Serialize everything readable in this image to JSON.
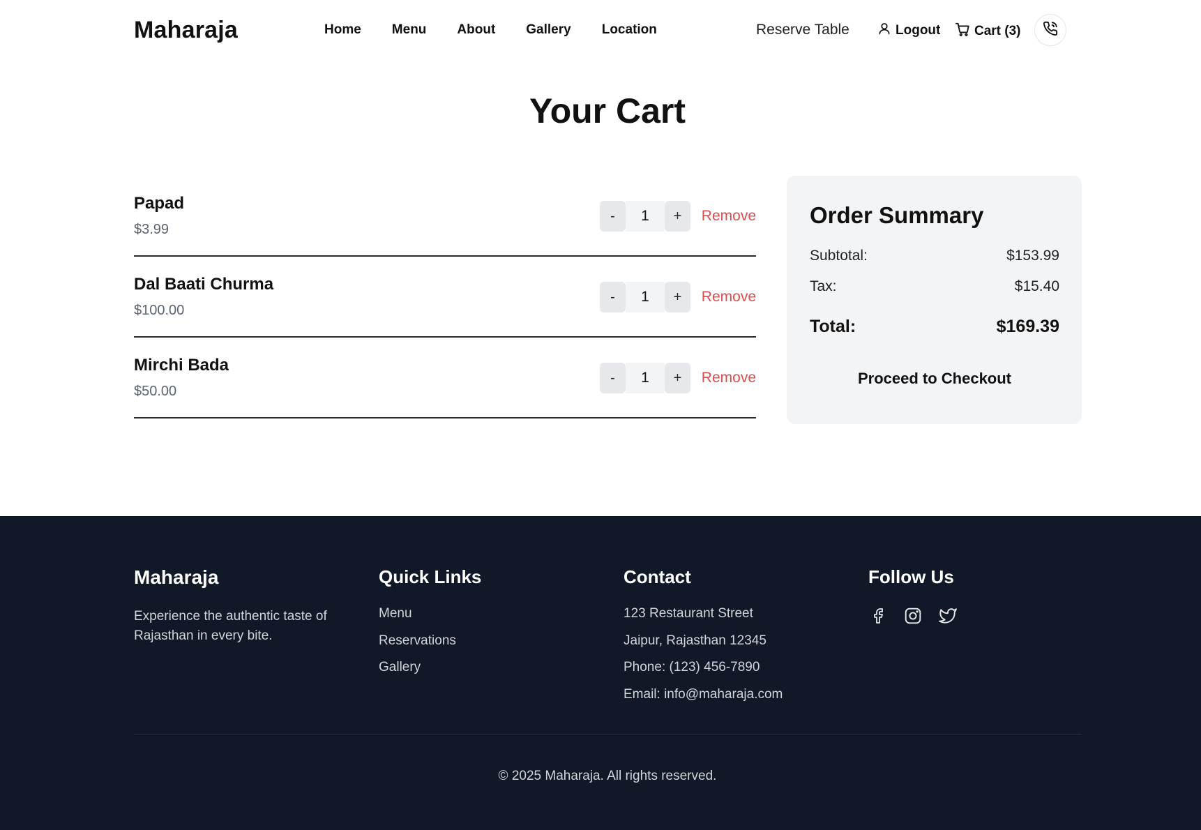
{
  "header": {
    "brand": "Maharaja",
    "nav": [
      "Home",
      "Menu",
      "About",
      "Gallery",
      "Location"
    ],
    "reserve_label": "Reserve Table",
    "logout_label": "Logout",
    "cart_label": "Cart (3)"
  },
  "page": {
    "title": "Your Cart"
  },
  "cart": {
    "items": [
      {
        "name": "Papad",
        "price": "$3.99",
        "qty": "1",
        "minus": "-",
        "plus": "+",
        "remove": "Remove"
      },
      {
        "name": "Dal Baati Churma",
        "price": "$100.00",
        "qty": "1",
        "minus": "-",
        "plus": "+",
        "remove": "Remove"
      },
      {
        "name": "Mirchi Bada",
        "price": "$50.00",
        "qty": "1",
        "minus": "-",
        "plus": "+",
        "remove": "Remove"
      }
    ]
  },
  "summary": {
    "title": "Order Summary",
    "subtotal_label": "Subtotal:",
    "subtotal_value": "$153.99",
    "tax_label": "Tax:",
    "tax_value": "$15.40",
    "total_label": "Total:",
    "total_value": "$169.39",
    "checkout_label": "Proceed to Checkout"
  },
  "footer": {
    "brand": "Maharaja",
    "tagline": "Experience the authentic taste of Rajasthan in every bite.",
    "quick_links_title": "Quick Links",
    "quick_links": [
      "Menu",
      "Reservations",
      "Gallery"
    ],
    "contact_title": "Contact",
    "contact": [
      "123 Restaurant Street",
      "Jaipur, Rajasthan 12345",
      "Phone: (123) 456-7890",
      "Email: info@maharaja.com"
    ],
    "follow_title": "Follow Us",
    "copyright": "© 2025 Maharaja. All rights reserved."
  },
  "colors": {
    "remove": "#e04b4b",
    "footer_bg": "#111827",
    "summary_bg": "#f3f4f6"
  },
  "icons": [
    "user-icon",
    "cart-icon",
    "phone-icon",
    "facebook-icon",
    "instagram-icon",
    "twitter-icon"
  ]
}
